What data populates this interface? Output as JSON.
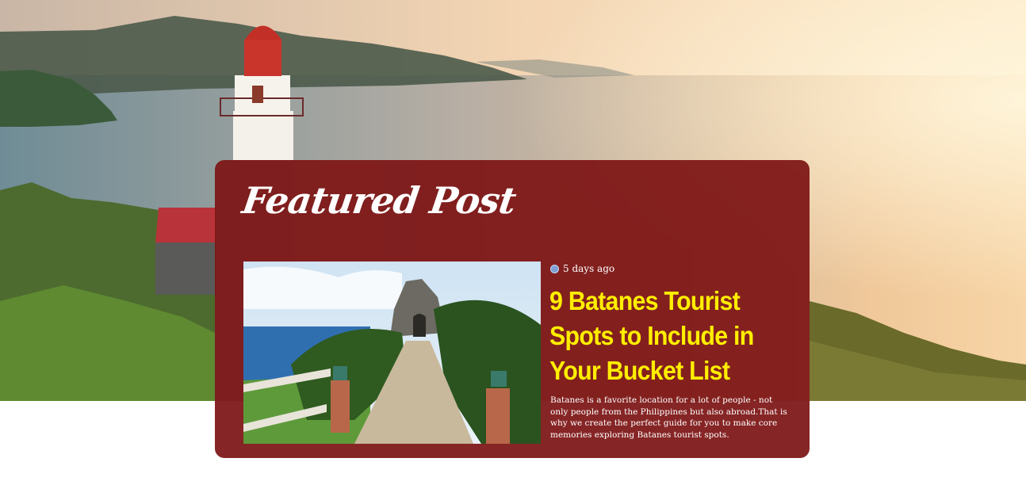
{
  "section": {
    "title": "Featured Post"
  },
  "featured_post": {
    "time_ago": "5 days ago",
    "title": "9 Batanes Tourist Spots to Include in Your Bucket List",
    "excerpt": "Batanes is a favorite location for a lot of people - not only people from the Philippines but also abroad.That is why we create the perfect guide for you to make core memories exploring Batanes tourist spots."
  },
  "colors": {
    "card_background": "#7d1414",
    "title_accent": "#ffee00"
  }
}
